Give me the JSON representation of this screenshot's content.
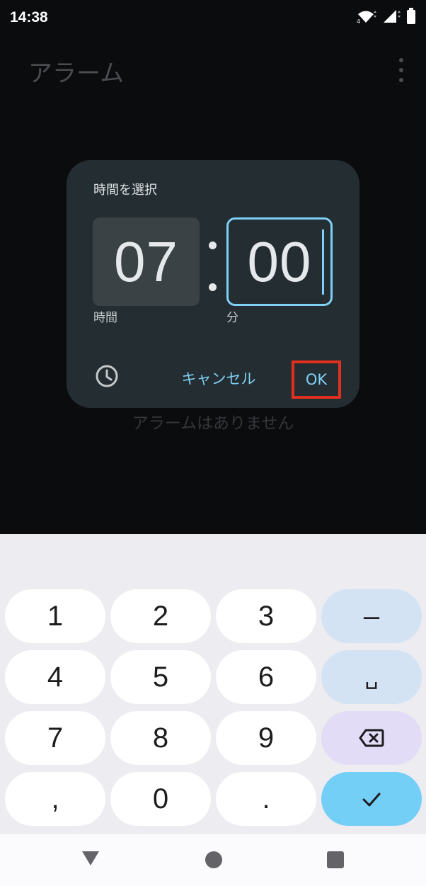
{
  "status_bar": {
    "time": "14:38",
    "icons": [
      "wifi-4g-icon",
      "signal-icon",
      "battery-icon"
    ]
  },
  "app_bar": {
    "title": "アラーム",
    "menu_icon": "more-vert-icon"
  },
  "empty_state": "アラームはありません",
  "time_picker": {
    "title": "時間を選択",
    "hour": "07",
    "minute": "00",
    "hour_label": "時間",
    "minute_label": "分",
    "mode_toggle_icon": "clock-icon",
    "cancel_label": "キャンセル",
    "ok_label": "OK"
  },
  "keyboard": {
    "keys": [
      {
        "label": "1",
        "name": "key-1"
      },
      {
        "label": "2",
        "name": "key-2"
      },
      {
        "label": "3",
        "name": "key-3"
      },
      {
        "label": "–",
        "name": "key-minus"
      },
      {
        "label": "4",
        "name": "key-4"
      },
      {
        "label": "5",
        "name": "key-5"
      },
      {
        "label": "6",
        "name": "key-6"
      },
      {
        "label": "␣",
        "name": "key-space"
      },
      {
        "label": "7",
        "name": "key-7"
      },
      {
        "label": "8",
        "name": "key-8"
      },
      {
        "label": "9",
        "name": "key-9"
      },
      {
        "label": "",
        "name": "key-backspace"
      },
      {
        "label": ",",
        "name": "key-comma"
      },
      {
        "label": "0",
        "name": "key-0"
      },
      {
        "label": ".",
        "name": "key-period"
      },
      {
        "label": "",
        "name": "key-enter"
      }
    ]
  },
  "nav_bar": {
    "icons": [
      "back-icon",
      "home-icon",
      "recents-icon"
    ]
  },
  "colors": {
    "accent": "#7fd0f5",
    "dialog_background": "#242d31",
    "highlight": "#e0301e"
  }
}
